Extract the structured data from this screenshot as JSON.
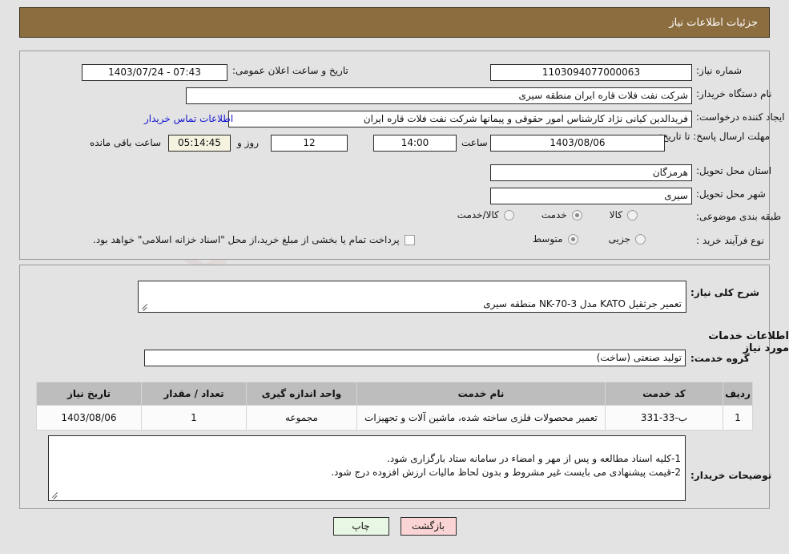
{
  "header": {
    "title": "جزئیات اطلاعات نیاز"
  },
  "colors": {
    "header_bg": "#8c6d3f",
    "page_bg": "#e3e3e3",
    "link": "#1414d2",
    "table_header_bg": "#bdbdbd",
    "countdown_bg": "#f5f3e0",
    "print_button_bg": "#e8f6e4",
    "back_button_bg": "#fbd5d5"
  },
  "watermark": {
    "text": "AriaTender.net"
  },
  "top_panel": {
    "need_number": {
      "label": "شماره نیاز:",
      "value": "1103094077000063"
    },
    "public_announcement": {
      "label": "تاریخ و ساعت اعلان عمومی:",
      "value": "07:43 - 1403/07/24"
    },
    "buyer_org": {
      "label": "نام دستگاه خریدار:",
      "value": "شرکت نفت فلات قاره ایران منطقه سیری"
    },
    "request_creator": {
      "label": "ایجاد کننده درخواست:",
      "value": "فریدالدین کیانی نژاد کارشناس امور حقوقی و پیمانها شرکت نفت فلات قاره ایران",
      "contact_link": "اطلاعات تماس خریدار"
    },
    "deadline": {
      "label": "مهلت ارسال پاسخ: تا تاریخ:",
      "date": "1403/08/06",
      "hour_label": "ساعت",
      "time": "14:00",
      "days": "12",
      "days_suffix": "روز و",
      "countdown": "05:14:45",
      "countdown_suffix": "ساعت باقی مانده"
    },
    "delivery_province": {
      "label": "استان محل تحویل:",
      "value": "هرمزگان"
    },
    "delivery_city": {
      "label": "شهر محل تحویل:",
      "value": "سیری"
    },
    "category": {
      "label": "طبقه بندی موضوعی:",
      "options": [
        {
          "label": "کالا",
          "selected": false
        },
        {
          "label": "خدمت",
          "selected": true
        },
        {
          "label": "کالا/خدمت",
          "selected": false
        }
      ]
    },
    "process_type": {
      "label": "نوع فرآیند خرید :",
      "options": [
        {
          "label": "جزیی",
          "selected": false
        },
        {
          "label": "متوسط",
          "selected": true
        }
      ],
      "treasury_checkbox": {
        "label": "پرداخت تمام یا بخشی از مبلغ خرید،از محل \"اسناد خزانه اسلامی\" خواهد بود.",
        "checked": false
      }
    }
  },
  "bottom_panel": {
    "general_description": {
      "label": "شرح کلی نیاز:",
      "value": "تعمیر جرثقیل KATO مدل NK-70-3 منطقه سیری"
    },
    "services_section_title": "اطلاعات خدمات مورد نیاز",
    "service_group": {
      "label": "گروه خدمت:",
      "value": "تولید صنعتی (ساخت)"
    },
    "table": {
      "headers": [
        "ردیف",
        "کد خدمت",
        "نام خدمت",
        "واحد اندازه گیری",
        "تعداد / مقدار",
        "تاریخ نیاز"
      ],
      "rows": [
        {
          "row": "1",
          "code": "ب-33-331",
          "name": "تعمیر محصولات فلزی ساخته شده، ماشین آلات و تجهیزات",
          "unit": "مجموعه",
          "quantity": "1",
          "date": "1403/08/06"
        }
      ]
    },
    "buyer_notes": {
      "label": "توضیحات خریدار:",
      "value": "1-کلیه اسناد مطالعه و پس از مهر و امضاء در سامانه ستاد بارگزاری شود.\n2-قیمت پیشنهادی می بایست غیر مشروط و بدون لحاظ مالیات ارزش افزوده درج شود."
    }
  },
  "footer": {
    "print_label": "چاپ",
    "back_label": "بازگشت"
  }
}
